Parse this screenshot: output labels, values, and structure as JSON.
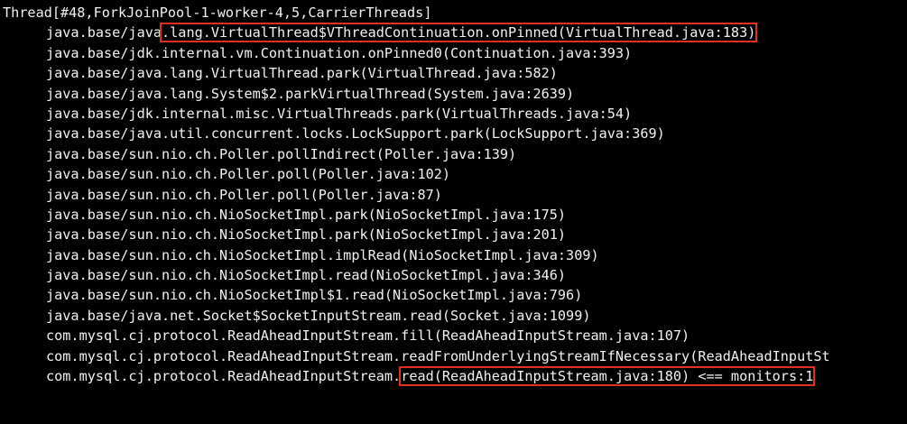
{
  "colors": {
    "background": "#000000",
    "text": "#f2f2f2",
    "highlight_box": "#e0301e"
  },
  "terminal": {
    "header": "Thread[#48,ForkJoinPool-1-worker-4,5,CarrierThreads]",
    "frames": [
      {
        "pre": "java.base/java",
        "hl": ".lang.VirtualThread$VThreadContinuation.onPinned(VirtualThread.java:183)",
        "post": ""
      },
      {
        "pre": "java.base/jdk.internal.vm.Continuation.onPinned0(Continuation.java:393)",
        "hl": "",
        "post": ""
      },
      {
        "pre": "java.base/java.lang.VirtualThread.park(VirtualThread.java:582)",
        "hl": "",
        "post": ""
      },
      {
        "pre": "java.base/java.lang.System$2.parkVirtualThread(System.java:2639)",
        "hl": "",
        "post": ""
      },
      {
        "pre": "java.base/jdk.internal.misc.VirtualThreads.park(VirtualThreads.java:54)",
        "hl": "",
        "post": ""
      },
      {
        "pre": "java.base/java.util.concurrent.locks.LockSupport.park(LockSupport.java:369)",
        "hl": "",
        "post": ""
      },
      {
        "pre": "java.base/sun.nio.ch.Poller.pollIndirect(Poller.java:139)",
        "hl": "",
        "post": ""
      },
      {
        "pre": "java.base/sun.nio.ch.Poller.poll(Poller.java:102)",
        "hl": "",
        "post": ""
      },
      {
        "pre": "java.base/sun.nio.ch.Poller.poll(Poller.java:87)",
        "hl": "",
        "post": ""
      },
      {
        "pre": "java.base/sun.nio.ch.NioSocketImpl.park(NioSocketImpl.java:175)",
        "hl": "",
        "post": ""
      },
      {
        "pre": "java.base/sun.nio.ch.NioSocketImpl.park(NioSocketImpl.java:201)",
        "hl": "",
        "post": ""
      },
      {
        "pre": "java.base/sun.nio.ch.NioSocketImpl.implRead(NioSocketImpl.java:309)",
        "hl": "",
        "post": ""
      },
      {
        "pre": "java.base/sun.nio.ch.NioSocketImpl.read(NioSocketImpl.java:346)",
        "hl": "",
        "post": ""
      },
      {
        "pre": "java.base/sun.nio.ch.NioSocketImpl$1.read(NioSocketImpl.java:796)",
        "hl": "",
        "post": ""
      },
      {
        "pre": "java.base/java.net.Socket$SocketInputStream.read(Socket.java:1099)",
        "hl": "",
        "post": ""
      },
      {
        "pre": "com.mysql.cj.protocol.ReadAheadInputStream.fill(ReadAheadInputStream.java:107)",
        "hl": "",
        "post": ""
      },
      {
        "pre": "com.mysql.cj.protocol.ReadAheadInputStream.readFromUnderlyingStreamIfNecessary(ReadAheadInputSt",
        "hl": "",
        "post": ""
      },
      {
        "pre": "com.mysql.cj.protocol.ReadAheadInputStream.",
        "hl": "read(ReadAheadInputStream.java:180) <== monitors:1",
        "post": ""
      }
    ]
  }
}
